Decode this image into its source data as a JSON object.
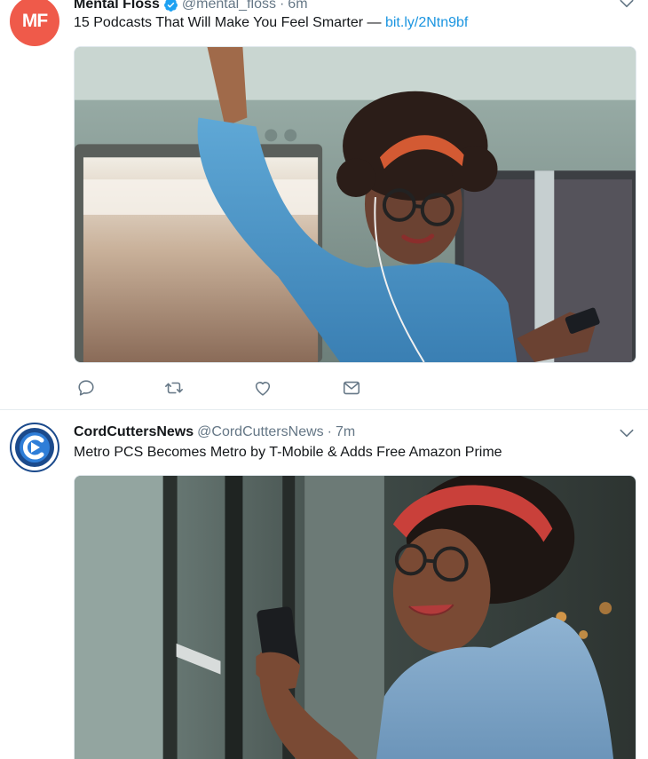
{
  "tweets": [
    {
      "name": "Mental Floss",
      "verified": true,
      "handle": "@mental_floss",
      "separator": "·",
      "time": "6m",
      "avatar_text": "MF",
      "text": "15 Podcasts That Will Make You Feel Smarter — ",
      "link": "bit.ly/2Ntn9bf",
      "avatar_color": "#ef5a4a",
      "actions": [
        "reply-icon",
        "retweet-icon",
        "like-icon",
        "direct-message-icon"
      ]
    },
    {
      "name": "CordCuttersNews",
      "verified": false,
      "handle": "@CordCuttersNews",
      "separator": "·",
      "time": "7m",
      "text": "Metro PCS Becomes Metro by T-Mobile & Adds Free Amazon Prime",
      "avatar_color": "#1b4a8c"
    }
  ],
  "colors": {
    "link": "#1b95e0",
    "muted": "#657786",
    "verified": "#1da1f2"
  }
}
